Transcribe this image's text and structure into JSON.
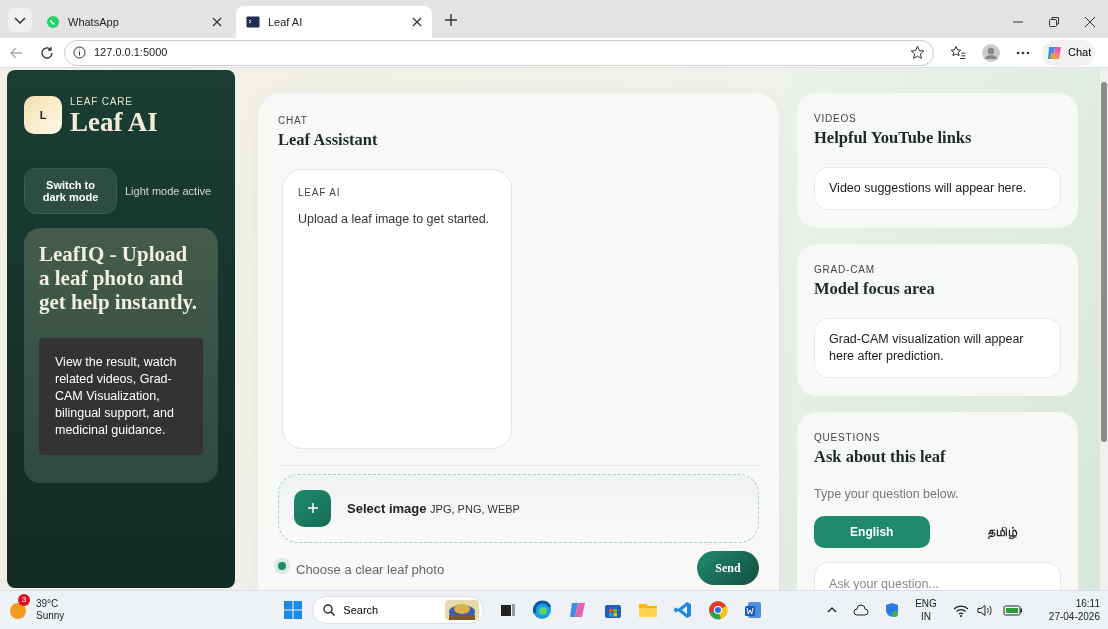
{
  "browser": {
    "tabs": [
      {
        "title": "WhatsApp",
        "selected": false
      },
      {
        "title": "Leaf AI",
        "selected": true
      }
    ],
    "url": "127.0.0.1:5000",
    "chat_button": "Chat"
  },
  "sidebar": {
    "logo_letter": "L",
    "kicker": "LEAF CARE",
    "title": "Leaf AI",
    "theme_button": "Switch to dark mode",
    "theme_status": "Light mode active",
    "hero_title": "LeafIQ - Upload a leaf photo and get help instantly.",
    "hero_text": "View the result, watch related videos, Grad-CAM Visualization, bilingual support, and medicinal guidance."
  },
  "chat": {
    "kicker": "CHAT",
    "title": "Leaf Assistant",
    "messages": [
      {
        "sender": "LEAF AI",
        "text": "Upload a leaf image to get started."
      }
    ],
    "upload_label": "Select image",
    "upload_hint": "JPG, PNG, WEBP",
    "status": "Choose a clear leaf photo",
    "send_button": "Send"
  },
  "panels": [
    {
      "kind": "info",
      "kicker": "VIDEOS",
      "title": "Helpful YouTube links",
      "text": "Video suggestions will appear here."
    },
    {
      "kind": "info",
      "kicker": "GRAD-CAM",
      "title": "Model focus area",
      "text": "Grad-CAM visualization will appear here after prediction."
    },
    {
      "kind": "questions",
      "kicker": "QUESTIONS",
      "title": "Ask about this leaf",
      "hint": "Type your question below.",
      "languages": [
        {
          "label": "English",
          "selected": true
        },
        {
          "label": "தமிழ்",
          "selected": false
        }
      ],
      "placeholder": "Ask your question..."
    }
  ],
  "taskbar": {
    "weather": {
      "badge": "3",
      "temperature": "39°C",
      "condition": "Sunny"
    },
    "search_label": "Search",
    "language": "ENG",
    "region": "IN",
    "time": "16:11",
    "date": "27-04-2026"
  }
}
